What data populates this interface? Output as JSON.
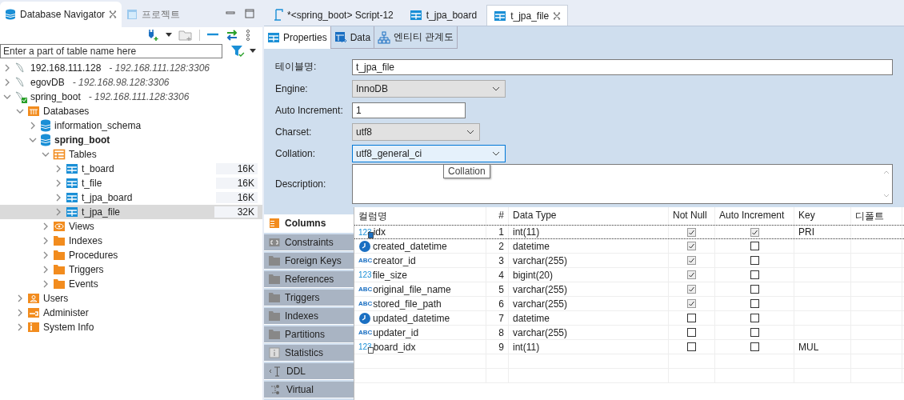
{
  "navigator": {
    "tabs": [
      {
        "label": "Database Navigator",
        "kind": "navigator",
        "selected": true
      },
      {
        "label": "프로젝트",
        "kind": "project",
        "selected": false
      }
    ],
    "filter": {
      "placeholder": "Enter a part of table name here"
    },
    "tree": [
      {
        "label": "192.168.111.128",
        "detail": "- 192.168.111.128:3306",
        "kind": "connection",
        "expanded": false,
        "connected": false
      },
      {
        "label": "egovDB",
        "detail": "- 192.168.98.128:3306",
        "kind": "connection",
        "expanded": false,
        "connected": false
      },
      {
        "label": "spring_boot",
        "detail": "- 192.168.111.128:3306",
        "kind": "connection",
        "expanded": true,
        "connected": true,
        "children": [
          {
            "label": "Databases",
            "kind": "databases",
            "expanded": true,
            "children": [
              {
                "label": "information_schema",
                "kind": "database",
                "expanded": false,
                "active": false
              },
              {
                "label": "spring_boot",
                "kind": "database",
                "expanded": true,
                "active": true,
                "children": [
                  {
                    "label": "Tables",
                    "kind": "tables",
                    "expanded": true,
                    "children": [
                      {
                        "label": "t_board",
                        "kind": "table",
                        "size": "16K",
                        "expanded": false,
                        "selected": false
                      },
                      {
                        "label": "t_file",
                        "kind": "table",
                        "size": "16K",
                        "expanded": false,
                        "selected": false
                      },
                      {
                        "label": "t_jpa_board",
                        "kind": "table",
                        "size": "16K",
                        "expanded": false,
                        "selected": false
                      },
                      {
                        "label": "t_jpa_file",
                        "kind": "table",
                        "size": "32K",
                        "expanded": false,
                        "selected": true
                      }
                    ]
                  },
                  {
                    "label": "Views",
                    "kind": "views",
                    "expanded": false
                  },
                  {
                    "label": "Indexes",
                    "kind": "folder",
                    "expanded": false
                  },
                  {
                    "label": "Procedures",
                    "kind": "folder",
                    "expanded": false
                  },
                  {
                    "label": "Triggers",
                    "kind": "folder",
                    "expanded": false
                  },
                  {
                    "label": "Events",
                    "kind": "folder",
                    "expanded": false
                  }
                ]
              }
            ]
          },
          {
            "label": "Users",
            "kind": "users",
            "expanded": false
          },
          {
            "label": "Administer",
            "kind": "admin",
            "expanded": false
          },
          {
            "label": "System Info",
            "kind": "info",
            "expanded": false
          }
        ]
      }
    ]
  },
  "editor": {
    "tabs": [
      {
        "label": "*<spring_boot> Script-12",
        "kind": "script",
        "selected": false
      },
      {
        "label": "t_jpa_board",
        "kind": "table",
        "selected": false
      },
      {
        "label": "t_jpa_file",
        "kind": "table",
        "selected": true
      }
    ],
    "subtabs": [
      {
        "label": "Properties",
        "kind": "properties",
        "selected": true
      },
      {
        "label": "Data",
        "kind": "data",
        "selected": false
      },
      {
        "label": "엔티티 관계도",
        "kind": "diagram",
        "selected": false
      }
    ],
    "fields": [
      {
        "label": "테이블명:",
        "kind": "text",
        "value": "t_jpa_file",
        "focused": false
      },
      {
        "label": "Engine:",
        "kind": "select",
        "value": "InnoDB",
        "focused": false
      },
      {
        "label": "Auto Increment:",
        "kind": "text",
        "value": "1",
        "focused": false
      },
      {
        "label": "Charset:",
        "kind": "select",
        "value": "utf8",
        "focused": false
      },
      {
        "label": "Collation:",
        "kind": "select",
        "value": "utf8_general_ci",
        "focused": true,
        "tooltip": "Collation"
      },
      {
        "label": "Description:",
        "kind": "textarea",
        "focused": false
      }
    ],
    "sections": [
      {
        "label": "Columns",
        "kind": "columns",
        "selected": true
      },
      {
        "label": "Constraints",
        "kind": "constraints",
        "selected": false
      },
      {
        "label": "Foreign Keys",
        "kind": "folder",
        "selected": false
      },
      {
        "label": "References",
        "kind": "folder",
        "selected": false
      },
      {
        "label": "Triggers",
        "kind": "folder",
        "selected": false
      },
      {
        "label": "Indexes",
        "kind": "folder",
        "selected": false
      },
      {
        "label": "Partitions",
        "kind": "folder",
        "selected": false
      },
      {
        "label": "Statistics",
        "kind": "statistics",
        "selected": false
      },
      {
        "label": "DDL",
        "kind": "ddl",
        "selected": false
      },
      {
        "label": "Virtual",
        "kind": "virtual",
        "selected": false
      }
    ],
    "table": {
      "columns": [
        "컬럼명",
        "#",
        "Data Type",
        "Not Null",
        "Auto Increment",
        "Key",
        "디폴트"
      ],
      "rows": [
        {
          "name": "idx",
          "kind": "primary-key",
          "icon_text": "123",
          "num": "1",
          "data_type": "int(11)",
          "not_null": true,
          "auto_increment": true,
          "key": "PRI",
          "selected": true
        },
        {
          "name": "created_datetime",
          "kind": "datetime",
          "num": "2",
          "data_type": "datetime",
          "not_null": true,
          "auto_increment": false,
          "selected": false
        },
        {
          "name": "creator_id",
          "kind": "string",
          "icon_text": "ABC",
          "num": "3",
          "data_type": "varchar(255)",
          "not_null": true,
          "auto_increment": false,
          "selected": false
        },
        {
          "name": "file_size",
          "kind": "plain",
          "icon_text": "123",
          "num": "4",
          "data_type": "bigint(20)",
          "not_null": true,
          "auto_increment": false,
          "selected": false
        },
        {
          "name": "original_file_name",
          "kind": "string",
          "icon_text": "ABC",
          "num": "5",
          "data_type": "varchar(255)",
          "not_null": true,
          "auto_increment": false,
          "selected": false
        },
        {
          "name": "stored_file_path",
          "kind": "string",
          "icon_text": "ABC",
          "num": "6",
          "data_type": "varchar(255)",
          "not_null": true,
          "auto_increment": false,
          "selected": false
        },
        {
          "name": "updated_datetime",
          "kind": "datetime",
          "num": "7",
          "data_type": "datetime",
          "not_null": false,
          "auto_increment": false,
          "selected": false
        },
        {
          "name": "updater_id",
          "kind": "string",
          "icon_text": "ABC",
          "num": "8",
          "data_type": "varchar(255)",
          "not_null": false,
          "auto_increment": false,
          "selected": false
        },
        {
          "name": "board_idx",
          "kind": "foreign-key",
          "icon_text": "123",
          "num": "9",
          "data_type": "int(11)",
          "not_null": false,
          "auto_increment": false,
          "key": "MUL",
          "selected": false
        }
      ]
    }
  }
}
